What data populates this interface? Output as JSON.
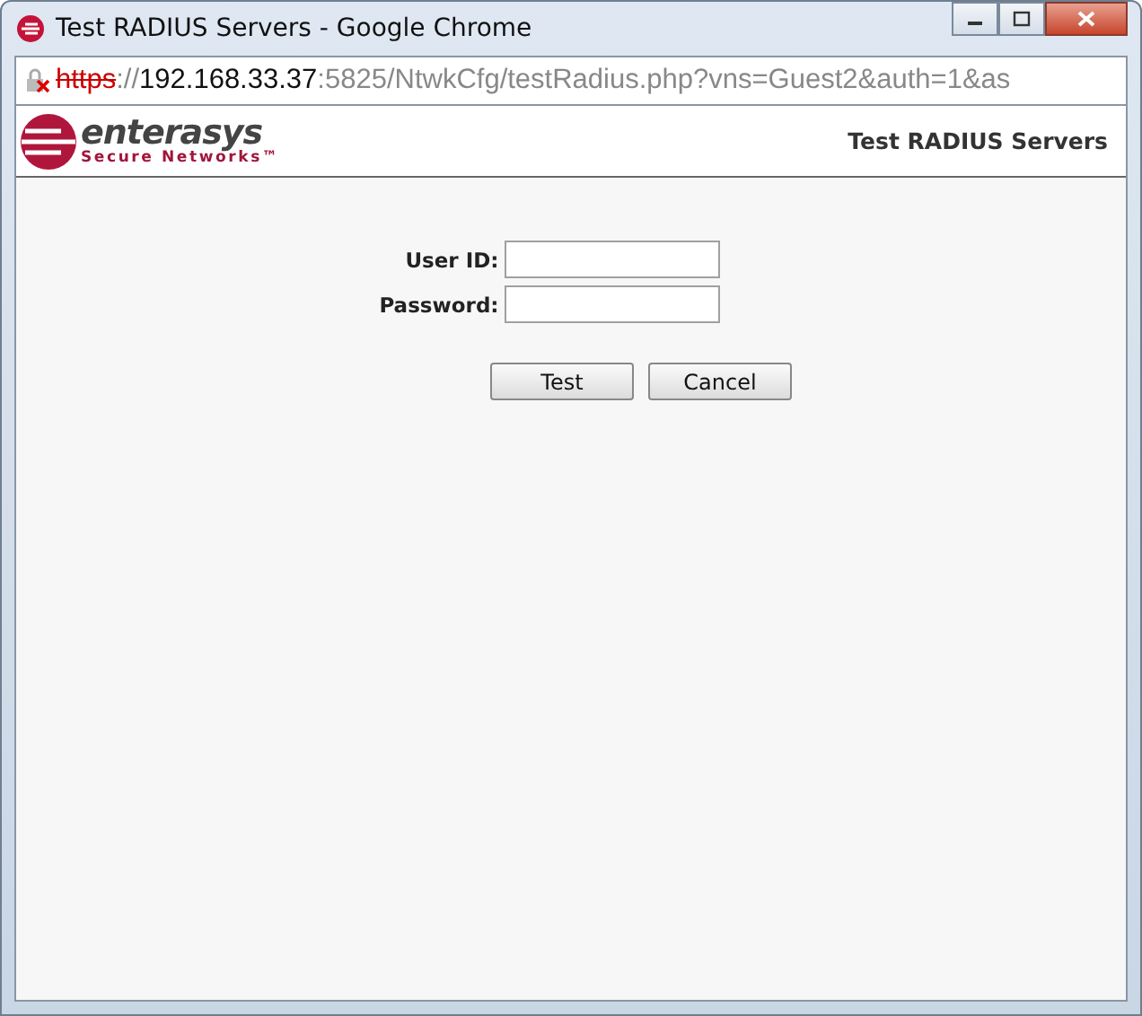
{
  "window": {
    "title": "Test RADIUS Servers - Google Chrome"
  },
  "address_bar": {
    "scheme": "https",
    "insecure": true,
    "separator": "://",
    "host": "192.168.33.37",
    "rest": ":5825/NtwkCfg/testRadius.php?vns=Guest2&auth=1&as"
  },
  "header": {
    "logo_name": "enterasys",
    "logo_tagline": "Secure Networks™",
    "page_title": "Test RADIUS Servers"
  },
  "form": {
    "fields": [
      {
        "label": "User ID:"
      },
      {
        "label": "Password:"
      }
    ],
    "buttons": [
      "Test",
      "Cancel"
    ]
  }
}
